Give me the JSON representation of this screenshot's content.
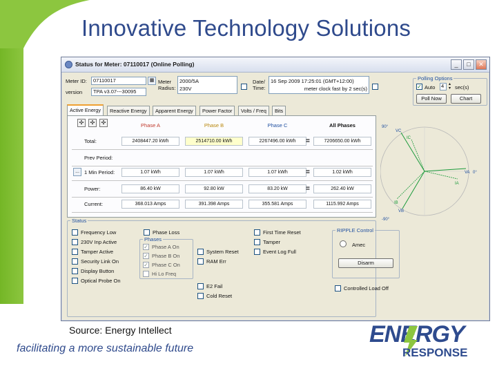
{
  "slide": {
    "title": "Innovative Technology Solutions",
    "source": "Source: Energy Intellect",
    "tagline": "facilitating a more sustainable future",
    "logo_top": "ENERGY",
    "logo_bottom": "RESPONSE",
    "accent_green": "#8cc63f",
    "accent_blue": "#2f4a8c"
  },
  "window": {
    "title": "Status for Meter: 07110017 (Online Polling)",
    "controls": {
      "minimize": "_",
      "maximize": "□",
      "close": "✕"
    }
  },
  "meter": {
    "id_label": "Meter ID:",
    "id_value": "07110017",
    "version_label": "version",
    "version_value": "TPA v3.07---30095",
    "meter_label": "Meter",
    "radius_label": "Radius:",
    "meter_lines": [
      "2000/5A",
      "230V"
    ],
    "date_label": "Date/",
    "time_label": "Time:",
    "datetime_value": "16 Sep 2009 17:25:01    (GMT+12:00)",
    "clock_note": "meter clock fast by 2 sec(s)"
  },
  "polling": {
    "title": "Polling Options",
    "auto_label": "Auto",
    "interval_value": "4",
    "sec_label": "sec(s)",
    "poll_now": "Poll Now",
    "chart": "Chart"
  },
  "tabs": [
    "Active Energy",
    "Reactive Energy",
    "Apparent Energy",
    "Power Factor",
    "Volts / Freq",
    "Bits"
  ],
  "energy": {
    "tools": [
      "✣",
      "✣",
      "✣"
    ],
    "columns": [
      "Phase A",
      "Phase B",
      "Phase C",
      "All Phases"
    ],
    "column_colors": [
      "#c0392b",
      "#b8860b",
      "#1f4fa0",
      "#111111"
    ],
    "rows": [
      {
        "label": "Total:",
        "a": "2408447.20 kWh",
        "b": "2514710.00 kWh",
        "c": "2267496.00 kWh",
        "all": "7206650.00 kWh",
        "eq": "="
      },
      {
        "label": "Prev Period:",
        "a": "",
        "b": "",
        "c": "",
        "all": "",
        "eq": ""
      },
      {
        "label": "1 Min Period:",
        "a": "1.07 kWh",
        "b": "1.07 kWh",
        "c": "1.07 kWh",
        "all": "1.02 kWh",
        "eq": "="
      },
      {
        "label": "Power:",
        "a": "86.40 kW",
        "b": "92.80 kW",
        "c": "83.20 kW",
        "all": "262.40 kW",
        "eq": "="
      },
      {
        "label": "Current:",
        "a": "368.013 Amps",
        "b": "391.398 Amps",
        "c": "355.581 Amps",
        "all": "1115.992 Amps",
        "eq": ""
      }
    ],
    "row_button": "..."
  },
  "phasor": {
    "top_label": "90°",
    "right_label": "0°",
    "bottom_label": "-90°",
    "labels": [
      "VC",
      "IC",
      "VA",
      "IA",
      "IB",
      "VB"
    ]
  },
  "status": {
    "title": "Status",
    "col1": [
      "Frequency Low",
      "230V Inp Active",
      "Tamper Active",
      "Security Link On",
      "Display Button",
      "Optical Probe On"
    ],
    "col2_top": "Phase Loss",
    "phases_title": "Phases",
    "phases": [
      {
        "label": "Phase A On",
        "checked": "✓"
      },
      {
        "label": "Phase B On",
        "checked": "✓"
      },
      {
        "label": "Phase C On",
        "checked": "✓"
      },
      {
        "label": "Hi Lo Freq",
        "checked": ""
      }
    ],
    "col3": [
      "System Reset",
      "RAM Err",
      "",
      "E2 Fail",
      "Cold Reset"
    ],
    "col4": [
      "First Time Reset",
      "Tamper",
      "Event Log Full"
    ],
    "ripple_title": "RIPPLE Control",
    "ripple_option": "Amec",
    "disarm": "Disarm",
    "controlled_load": "Controlled Load Off"
  }
}
